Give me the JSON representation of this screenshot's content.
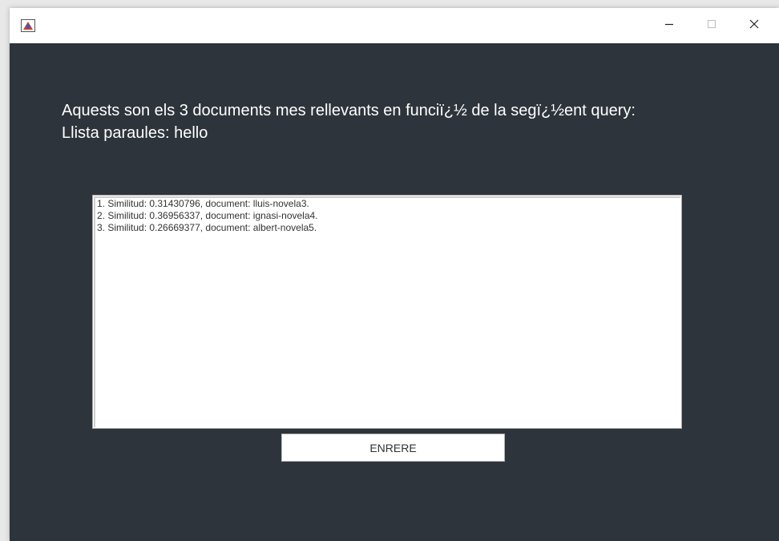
{
  "window": {
    "controls": {
      "minimize": "–",
      "close": "✕"
    },
    "app_icon": "java-app-icon"
  },
  "main": {
    "heading_line1": "Aquests son els 3 documents mes rellevants en funciï¿½ de la segï¿½ent query:",
    "heading_line2": "Llista paraules: hello",
    "results": [
      "1. Similitud: 0.31430796, document: lluis-novela3.",
      "2. Similitud: 0.36956337, document: ignasi-novela4.",
      "3. Similitud: 0.26669377, document: albert-novela5."
    ],
    "back_button_label": "ENRERE"
  },
  "colors": {
    "background": "#2e343b",
    "titlebar": "#ffffff",
    "text_light": "#ffffff",
    "text_dark": "#333333"
  }
}
